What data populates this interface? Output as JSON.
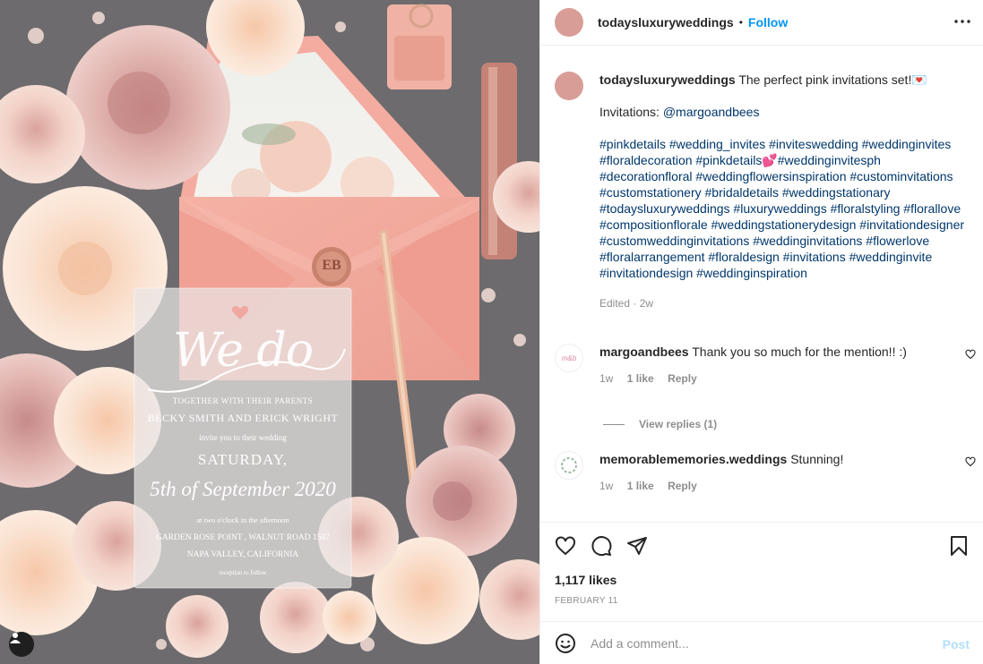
{
  "header": {
    "username": "todaysluxuryweddings",
    "separator": "•",
    "follow_label": "Follow"
  },
  "caption": {
    "username": "todaysluxuryweddings",
    "text": "The perfect pink invitations set!💌",
    "invitations_prefix": "Invitations: ",
    "mention": "@margoandbees",
    "hashtags": "#pinkdetails #wedding_invites #inviteswedding #weddinginvites #floraldecoration #pinkdetails💕#weddinginvitesph #decorationfloral #weddingflowersinspiration #custominvitations #customstationery #bridaldetails #weddingstationary #todaysluxuryweddings #luxuryweddings #floralstyling #florallove #compositionflorale #weddingstationerydesign #invitationdesigner #customweddinginvitations #weddinginvitations #flowerlove #floralarrangement #floraldesign #invitations #weddinginvite #invitationdesign #weddinginspiration",
    "edited_label": "Edited",
    "edited_sep": " · ",
    "edited_time": "2w"
  },
  "comments": [
    {
      "username": "margoandbees",
      "text": "Thank you so much for the mention!! :)",
      "time": "1w",
      "likes": "1 like",
      "reply": "Reply",
      "avatar_text": "m&b"
    },
    {
      "username": "memorablememories.weddings",
      "text": "Stunning!",
      "time": "1w",
      "likes": "1 like",
      "reply": "Reply",
      "avatar_text": ""
    }
  ],
  "view_replies": "View replies (1)",
  "likes_count": "1,117 likes",
  "post_date": "FEBRUARY 11",
  "add_comment": {
    "placeholder": "Add a comment...",
    "post_label": "Post"
  },
  "invitation_card": {
    "script": "We do",
    "line1": "TOGETHER WITH THEIR PARENTS",
    "line2": "BECKY SMITH AND ERICK WRIGHT",
    "line3": "invite you to their wedding",
    "line4": "SATURDAY,",
    "line5": "5th of September 2020",
    "line6": "at two o'clock in  the afternoon",
    "line7": "GARDEN ROSE POINT , WALNUT ROAD 1587",
    "line8": "NAPA VALLEY, CALIFORNIA",
    "line9": "reception to follow",
    "seal": "EB"
  },
  "colors": {
    "link": "#00376b",
    "follow": "#0095f6",
    "muted": "#8e8e8e",
    "post_disabled": "#b2dffc",
    "avatar": "#d89d97",
    "envelope": "#f2a598"
  },
  "icons": [
    "more-icon",
    "heart-icon",
    "comment-icon",
    "share-icon",
    "bookmark-icon",
    "emoji-icon",
    "user-tag-icon",
    "small-heart-icon"
  ]
}
